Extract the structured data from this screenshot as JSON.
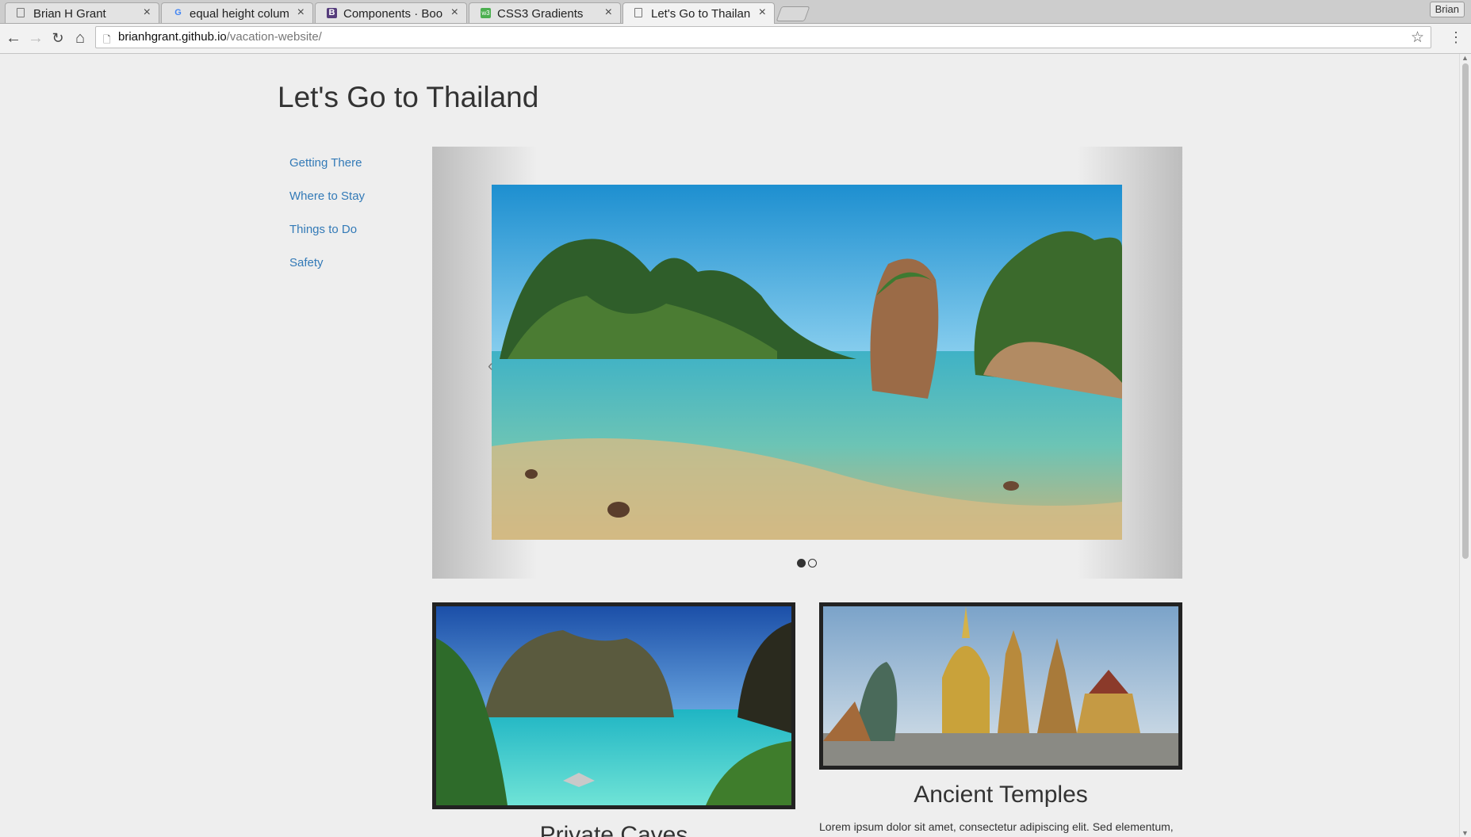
{
  "browser": {
    "tabs": [
      {
        "title": "Brian H Grant",
        "icon": "page-icon",
        "active": false
      },
      {
        "title": "equal height colum",
        "icon": "google-icon",
        "active": false
      },
      {
        "title": "Components · Boot",
        "icon": "bootstrap-icon",
        "active": false
      },
      {
        "title": "CSS3 Gradients",
        "icon": "w3-icon",
        "active": false
      },
      {
        "title": "Let's Go to Thailan",
        "icon": "page-icon",
        "active": true
      }
    ],
    "close_glyph": "×",
    "profile_name": "Brian",
    "url_host": "brianhgrant.github.io",
    "url_path": "/vacation-website/"
  },
  "page": {
    "title": "Let's Go to Thailand",
    "nav": [
      "Getting There",
      "Where to Stay",
      "Things to Do",
      "Safety"
    ],
    "carousel": {
      "prev_glyph": "‹",
      "slide_count": 2,
      "active_index": 0
    },
    "cards": [
      {
        "title": "Private Caves",
        "text": ""
      },
      {
        "title": "Ancient Temples",
        "text": "Lorem ipsum dolor sit amet, consectetur adipiscing elit. Sed elementum,"
      }
    ]
  },
  "colors": {
    "link": "#337ab7",
    "background": "#eeeeee",
    "frame": "#222222"
  }
}
